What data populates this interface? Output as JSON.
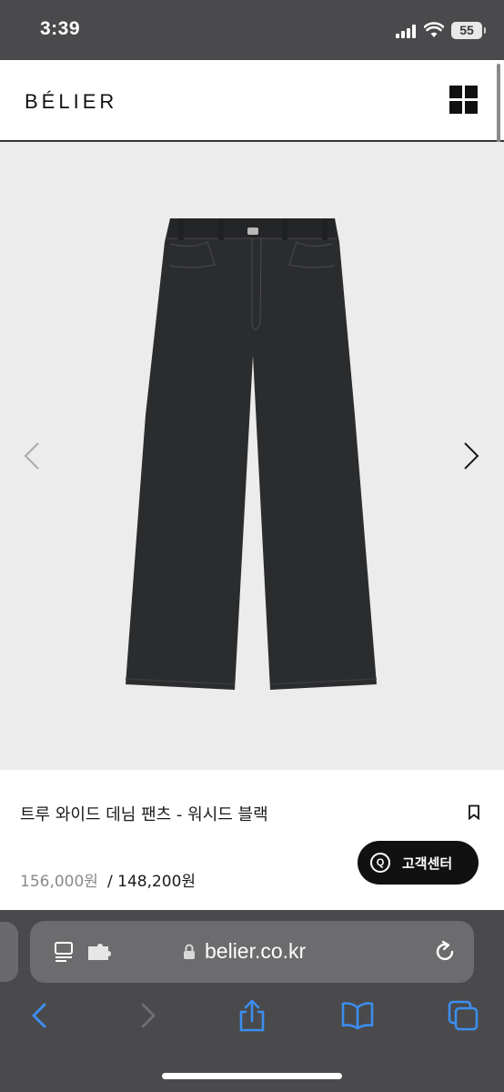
{
  "status_bar": {
    "time": "3:39",
    "battery": "55"
  },
  "header": {
    "brand": "BÉLIER",
    "menu_icon": "grid-menu-icon"
  },
  "gallery": {
    "prev_icon": "chevron-left-icon",
    "next_icon": "chevron-right-icon"
  },
  "product": {
    "name": "트루 와이드 데님 팬츠 - 워시드 블랙",
    "price_original": "156,000원",
    "price_sale": "/ 148,200원",
    "bookmark_icon": "bookmark-icon"
  },
  "cs_button": {
    "icon_letter": "Q",
    "label": "고객센터"
  },
  "browser": {
    "url": "belier.co.kr",
    "toolbar": [
      "back-icon",
      "forward-icon",
      "share-icon",
      "bookmarks-icon",
      "tabs-icon"
    ]
  },
  "colors": {
    "accent": "#3b8ef0",
    "chrome": "#4a4a4c",
    "button": "#111111"
  }
}
